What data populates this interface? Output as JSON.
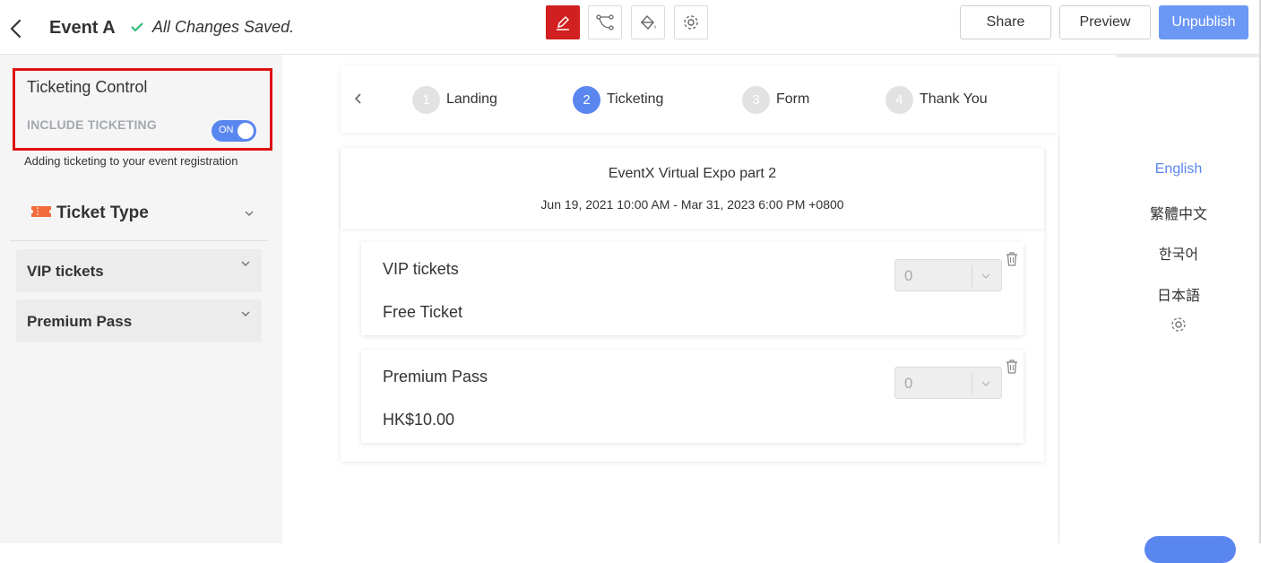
{
  "header": {
    "event_title": "Event A",
    "saved_status": "All Changes Saved.",
    "tools": [
      "edit-icon",
      "flow-icon",
      "paint-bucket-icon",
      "gear-icon"
    ],
    "share_label": "Share",
    "preview_label": "Preview",
    "unpublish_label": "Unpublish"
  },
  "sidebar": {
    "ticketing_control_title": "Ticketing Control",
    "include_ticketing_label": "INCLUDE TICKETING",
    "toggle_state": "ON",
    "hint": "Adding ticketing to your event registration",
    "ticket_type_title": "Ticket Type",
    "ticket_items": [
      {
        "label": "VIP tickets"
      },
      {
        "label": "Premium Pass"
      }
    ]
  },
  "steps": [
    {
      "number": "1",
      "label": "Landing",
      "active": false
    },
    {
      "number": "2",
      "label": "Ticketing",
      "active": true
    },
    {
      "number": "3",
      "label": "Form",
      "active": false
    },
    {
      "number": "4",
      "label": "Thank You",
      "active": false
    }
  ],
  "event": {
    "name": "EventX Virtual Expo part 2",
    "date_range": "Jun 19, 2021 10:00 AM - Mar 31, 2023 6:00 PM +0800"
  },
  "tickets": [
    {
      "name": "VIP tickets",
      "price": "Free Ticket",
      "quantity": "0"
    },
    {
      "name": "Premium Pass",
      "price": "HK$10.00",
      "quantity": "0"
    }
  ],
  "languages": [
    {
      "label": "English",
      "active": true
    },
    {
      "label": "繁體中文",
      "active": false
    },
    {
      "label": "한국어",
      "active": false
    },
    {
      "label": "日本語",
      "active": false
    }
  ],
  "colors": {
    "accent": "#5a86ef",
    "active_tool": "#d21f1f",
    "highlight_border": "#e01010"
  }
}
